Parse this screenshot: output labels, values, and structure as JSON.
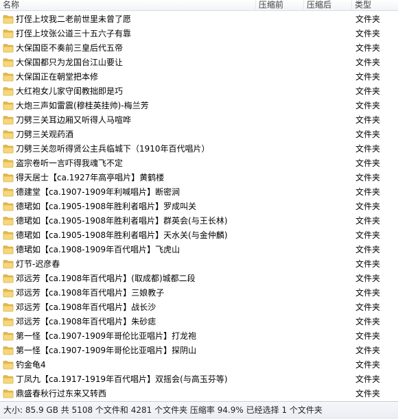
{
  "header": {
    "name": "名称",
    "compressed_size": "压缩前",
    "packed_size": "压缩后",
    "type": "类型"
  },
  "folder_icon": "folder-icon",
  "colors": {
    "folder_body": "#e8b84a",
    "folder_front": "#f6d77a",
    "status_bg": "#eef1f5"
  },
  "rows": [
    {
      "name": "打侄上坟我二老前世里未曾了愿",
      "type": "文件夹"
    },
    {
      "name": "打侄上坟张公道三十五六子有靠",
      "type": "文件夹"
    },
    {
      "name": "大保国臣不奏前三皇后代五帝",
      "type": "文件夹"
    },
    {
      "name": "大保国都只为龙国台江山要让",
      "type": "文件夹"
    },
    {
      "name": "大保国正在朝堂把本修",
      "type": "文件夹"
    },
    {
      "name": "大红袍女儿家守闺教拙即是巧",
      "type": "文件夹"
    },
    {
      "name": "大炮三声如雷震(穆桂英挂帅)-梅兰芳",
      "type": "文件夹"
    },
    {
      "name": "刀劈三关耳边厢又听得人马喧哗",
      "type": "文件夹"
    },
    {
      "name": "刀劈三关观药酒",
      "type": "文件夹"
    },
    {
      "name": "刀劈三关忽听得贤公主兵临城下（1910年百代唱片）",
      "type": "文件夹"
    },
    {
      "name": "盗宗卷听一言吓得我魂飞不定",
      "type": "文件夹"
    },
    {
      "name": "得天居士【ca.1927年高亭唱片】黄鹤楼",
      "type": "文件夹"
    },
    {
      "name": "德建堂【ca.1907-1909年利喊唱片】断密涧",
      "type": "文件夹"
    },
    {
      "name": "德珺如【ca.1905-1908年胜利者唱片】罗成叫关",
      "type": "文件夹"
    },
    {
      "name": "德珺如【ca.1905-1908年胜利者唱片】群英会(与王长林)",
      "type": "文件夹"
    },
    {
      "name": "德珺如【ca.1905-1908年胜利者唱片】天水关(与金仲麟)",
      "type": "文件夹"
    },
    {
      "name": "德珺如【ca.1908-1909年百代唱片】飞虎山",
      "type": "文件夹"
    },
    {
      "name": "灯节-迟彦春",
      "type": "文件夹"
    },
    {
      "name": "邓远芳【ca.1908年百代唱片】(取成都)城都二段",
      "type": "文件夹"
    },
    {
      "name": "邓远芳【ca.1908年百代唱片】三娘教子",
      "type": "文件夹"
    },
    {
      "name": "邓远芳【ca.1908年百代唱片】战长沙",
      "type": "文件夹"
    },
    {
      "name": "邓远芳【ca.1908年百代唱片】朱砂痣",
      "type": "文件夹"
    },
    {
      "name": "第一怪【ca.1907-1909年哥伦比亚唱片】打龙袍",
      "type": "文件夹"
    },
    {
      "name": "第一怪【ca.1907-1909年哥伦比亚唱片】探阴山",
      "type": "文件夹"
    },
    {
      "name": "钓金龟4",
      "type": "文件夹"
    },
    {
      "name": "丁凤九【ca.1917-1919年百代唱片】双摇会(与高玉芬等)",
      "type": "文件夹"
    },
    {
      "name": "鼎盛春秋行过东来又转西",
      "type": "文件夹"
    }
  ],
  "status": {
    "text": "大小: 85.9 GB 共 5108 个文件和 4281 个文件夹 压缩率 94.9% 已经选择 1 个文件夹"
  }
}
